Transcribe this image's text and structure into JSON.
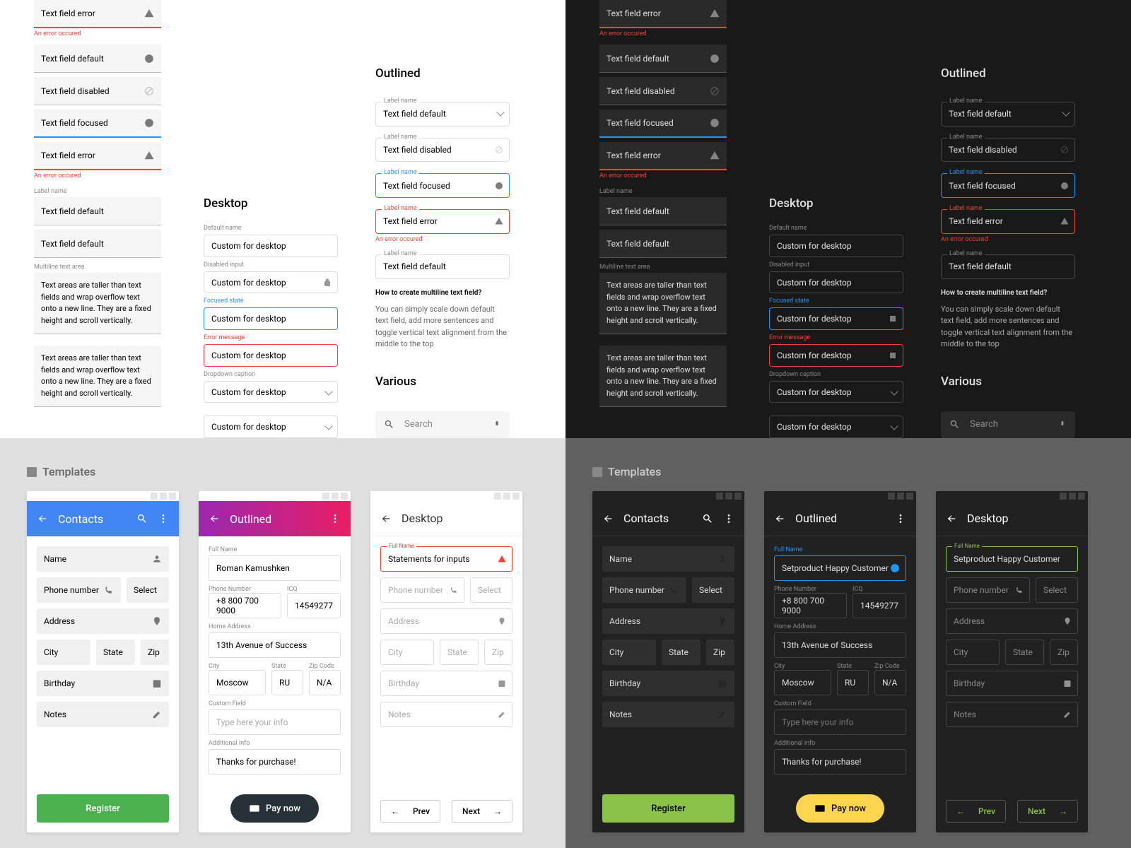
{
  "light": {
    "filled": {
      "error1_value": "Text field error",
      "error1_msg": "An error occured",
      "default_value": "Text field default",
      "disabled_value": "Text field disabled",
      "focused_value": "Text field focused",
      "error2_value": "Text field error",
      "error2_msg": "An error occured",
      "label_name": "Label name",
      "labeled_default": "Text field default",
      "default2": "Text field default",
      "mta_label": "Multiline text area",
      "mta_text": "Text areas are taller than text fields and wrap overflow text onto a new line. They are a fixed height and scroll vertically.",
      "mta_text2": "Text areas are taller than text fields and wrap overflow text onto a new line. They are a fixed height and scroll vertically."
    },
    "desktop": {
      "heading": "Desktop",
      "default_lbl": "Default name",
      "default_val": "Custom for desktop",
      "disabled_lbl": "Disabled input",
      "disabled_val": "Custom for desktop",
      "focused_lbl": "Focused state",
      "focused_val": "Custom for desktop",
      "error_lbl": "Error message",
      "error_val": "Custom for desktop",
      "dd_lbl": "Dropdown caption",
      "dd_val": "Custom for desktop",
      "dd2_val": "Custom for desktop"
    },
    "outlined": {
      "heading": "Outlined",
      "label": "Label name",
      "default_val": "Text field default",
      "disabled_val": "Text field disabled",
      "focused_val": "Text field focused",
      "error_val": "Text field error",
      "error_msg": "An error occured",
      "default2_val": "Text field default",
      "hint_title": "How to create multiline text field?",
      "hint_body": "You can simply scale down default text field, add more sentences and toggle vertical text alignment from the middle to the top"
    },
    "various": {
      "heading": "Various",
      "search": "Search"
    }
  },
  "templates": {
    "heading": "Templates",
    "contacts": {
      "title": "Contacts",
      "name": "Name",
      "phone": "Phone number",
      "select": "Select",
      "address": "Address",
      "city": "City",
      "state": "State",
      "zip": "Zip",
      "birthday": "Birthday",
      "notes": "Notes",
      "register": "Register"
    },
    "outlined": {
      "title": "Outlined",
      "fullname_lbl": "Full Name",
      "fullname_val": "Roman Kamushken",
      "phone_lbl": "Phone Number",
      "phone_val": "+8 800 700 9000",
      "icq_lbl": "ICQ",
      "icq_val": "14549277",
      "addr_lbl": "Home Address",
      "addr_val": "13th Avenue of Success",
      "city_lbl": "City",
      "city_val": "Moscow",
      "state_lbl": "State",
      "state_val": "RU",
      "zip_lbl": "Zip Code",
      "zip_val": "N/A",
      "custom_lbl": "Custom Field",
      "custom_ph": "Type here your info",
      "info_lbl": "Additional Info",
      "info_val": "Thanks for purchase!",
      "paynow": "Pay now"
    },
    "desktop": {
      "title": "Desktop",
      "fullname_lbl": "Full Name",
      "fullname_val": "Statements for inputs",
      "phone": "Phone number",
      "select": "Select",
      "address": "Address",
      "city": "City",
      "state": "State",
      "zip": "Zip",
      "birthday": "Birthday",
      "notes": "Notes",
      "prev": "Prev",
      "next": "Next"
    },
    "dark_outlined": {
      "fullname_val": "Setproduct Happy Customer"
    },
    "dark_desktop": {
      "fullname_val": "Setproduct Happy Customer"
    }
  },
  "icons": {
    "clear": "clear-icon",
    "disabled": "block-icon",
    "warn": "warning-icon",
    "lock": "lock-icon",
    "search": "search-icon",
    "mic": "mic-icon",
    "person": "person-icon",
    "phone": "phone-icon",
    "place": "place-icon",
    "cal": "calendar-icon",
    "edit": "edit-icon",
    "back": "arrow-back-icon",
    "more": "more-vert-icon",
    "card": "card-icon"
  }
}
